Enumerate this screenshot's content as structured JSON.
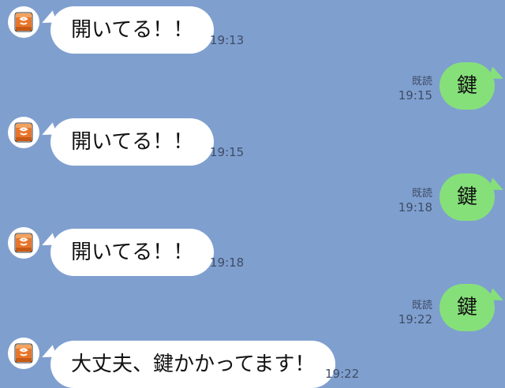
{
  "colors": {
    "background": "#7f9fcf",
    "incoming_bubble": "#ffffff",
    "outgoing_bubble": "#86e07a",
    "meta_text": "#3e4d66"
  },
  "messages": [
    {
      "direction": "incoming",
      "text": "開いてる！！",
      "time": "19:13",
      "avatar_icon": "orange-pouch-icon"
    },
    {
      "direction": "outgoing",
      "text": "鍵",
      "read": "既読",
      "time": "19:15"
    },
    {
      "direction": "incoming",
      "text": "開いてる！！",
      "time": "19:15",
      "avatar_icon": "orange-pouch-icon"
    },
    {
      "direction": "outgoing",
      "text": "鍵",
      "read": "既読",
      "time": "19:18"
    },
    {
      "direction": "incoming",
      "text": "開いてる！！",
      "time": "19:18",
      "avatar_icon": "orange-pouch-icon"
    },
    {
      "direction": "outgoing",
      "text": "鍵",
      "read": "既読",
      "time": "19:22"
    },
    {
      "direction": "incoming",
      "text": "大丈夫、鍵かかってます！",
      "time": "19:22",
      "avatar_icon": "orange-pouch-icon"
    }
  ]
}
